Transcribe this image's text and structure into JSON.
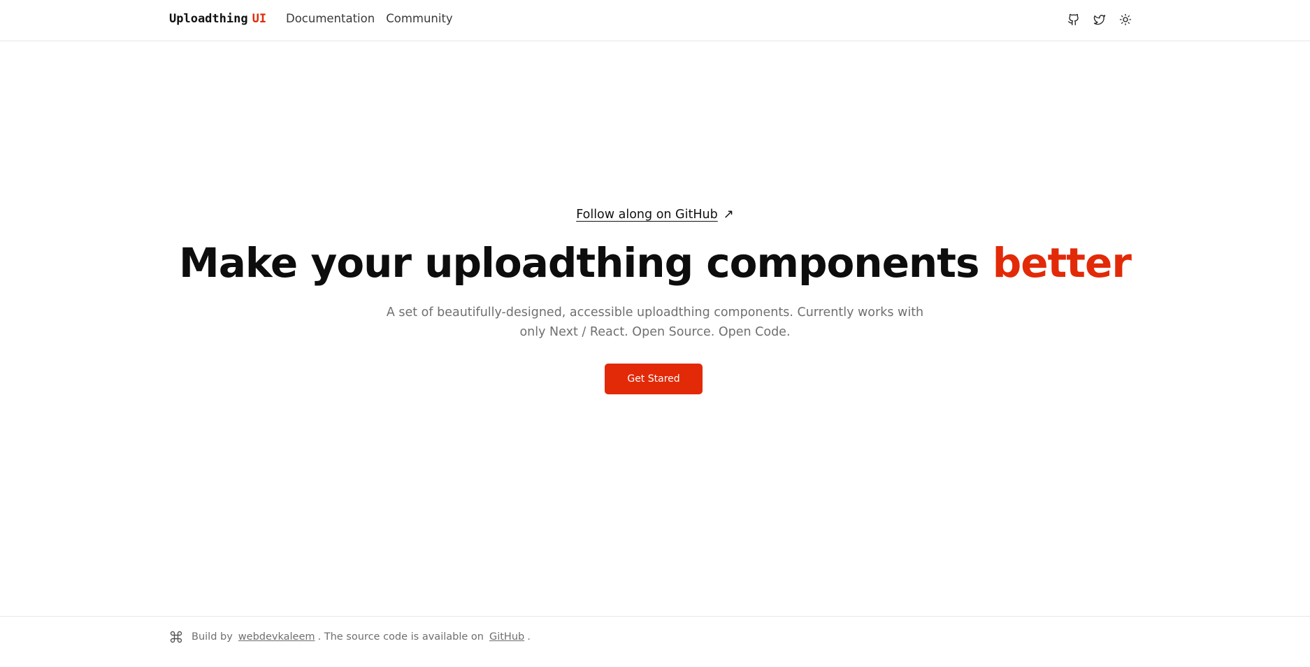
{
  "header": {
    "logo_main": "Uploadthing",
    "logo_accent": "UI",
    "nav": [
      {
        "label": "Documentation"
      },
      {
        "label": "Community"
      }
    ],
    "icons": [
      "github-icon",
      "twitter-icon",
      "sun-icon"
    ]
  },
  "hero": {
    "follow_link": "Follow along on GitHub",
    "follow_arrow": "↗",
    "title_main": "Make your uploadthing components",
    "title_accent": "better",
    "subtitle": "A set of beautifully-designed, accessible uploadthing components. Currently works with only Next / React. Open Source. Open Code.",
    "cta_label": "Get Stared"
  },
  "footer": {
    "prefix": "Build by",
    "author_link": "webdevkaleem",
    "middle": ". The source code is available on",
    "source_link": "GitHub",
    "suffix": "."
  },
  "colors": {
    "accent": "#e22a09",
    "text": "#0f0f0f",
    "muted": "#6f6f6f",
    "border": "#e7e7e7"
  }
}
